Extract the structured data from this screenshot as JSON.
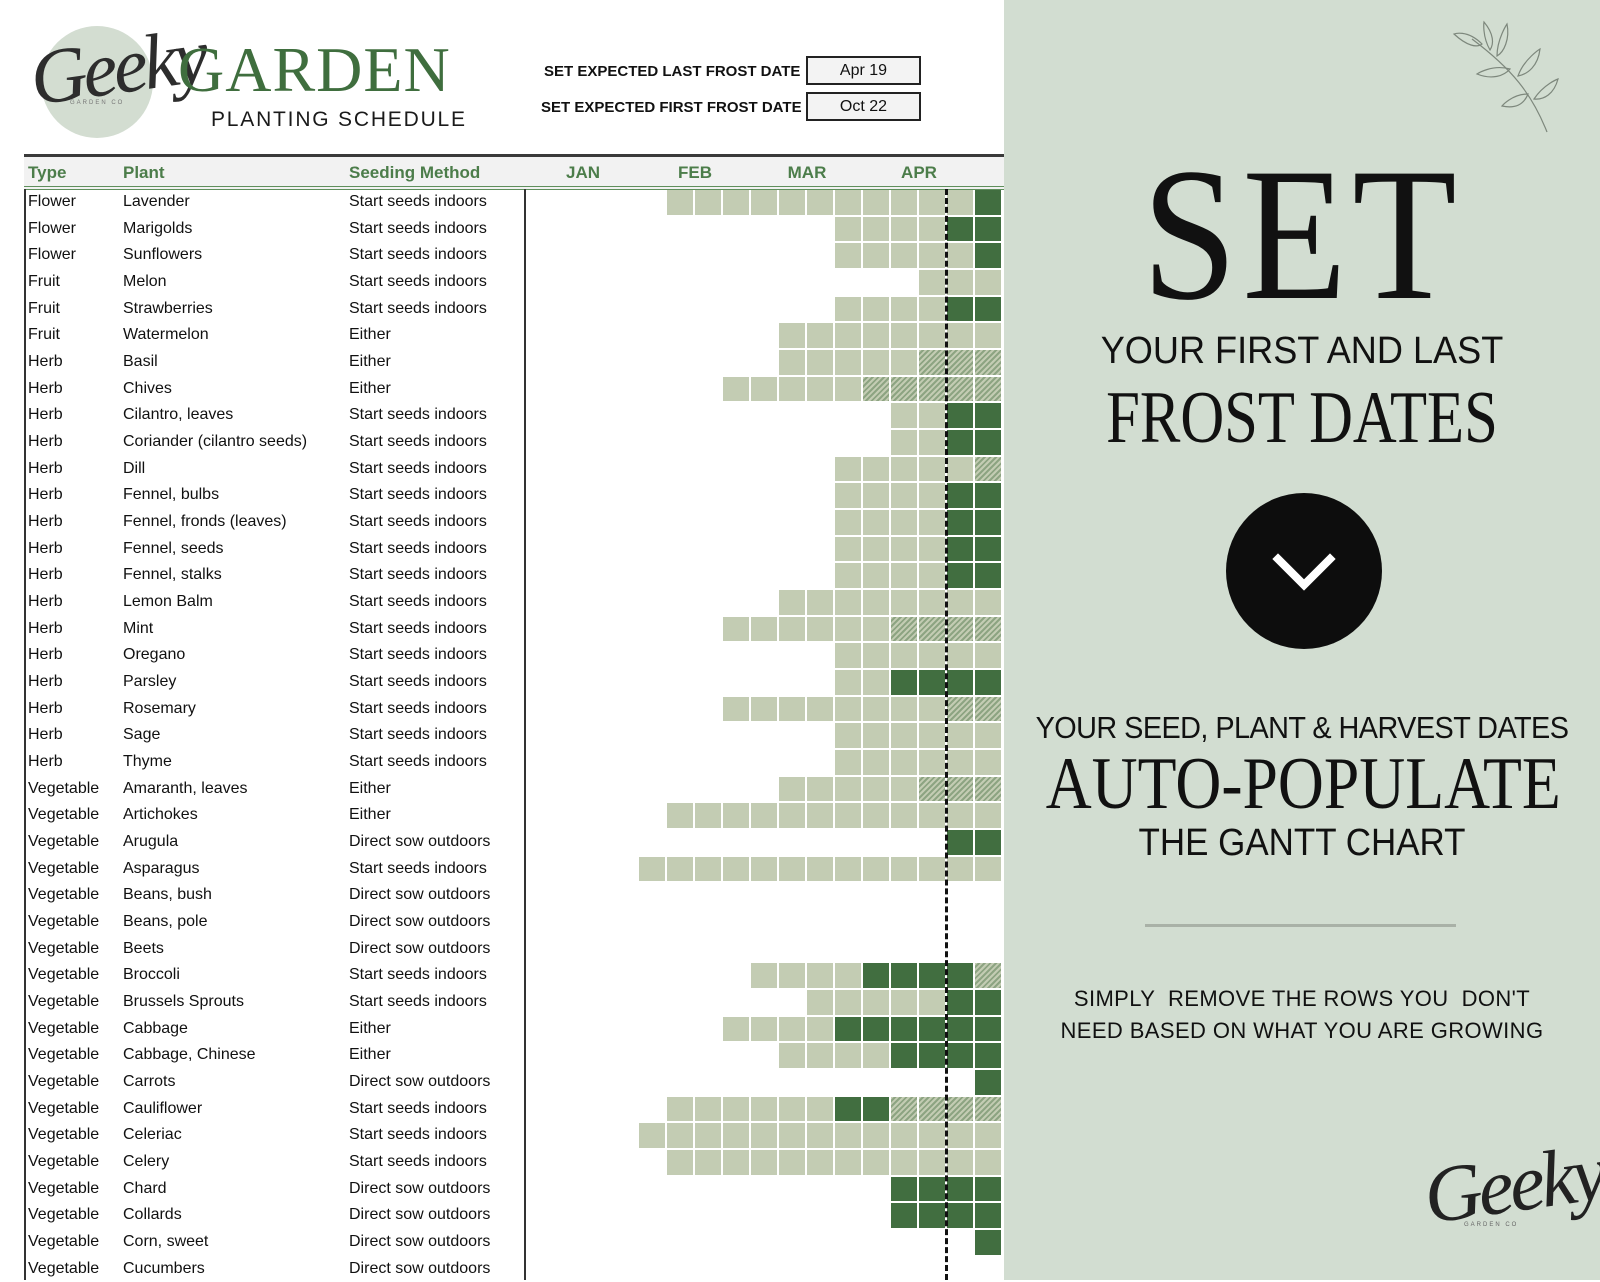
{
  "header": {
    "logo_script": "Geeky",
    "logo_sub": "GARDEN CO",
    "title": "GARDEN",
    "subtitle": "PLANTING SCHEDULE"
  },
  "frost": {
    "last_label": "SET EXPECTED LAST FROST DATE",
    "last_value": "Apr 19",
    "first_label": "SET EXPECTED FIRST FROST DATE",
    "first_value": "Oct 22"
  },
  "table": {
    "columns": [
      "Type",
      "Plant",
      "Seeding Method"
    ],
    "months": [
      "JAN",
      "FEB",
      "MAR",
      "APR"
    ]
  },
  "colors": {
    "light": "#c3ccb3",
    "dark": "#416e40",
    "hatched": "#8da482",
    "title_green": "#3f6e3e",
    "panel_bg": "#d2ddd1"
  },
  "chart_data": {
    "type": "gantt",
    "time_axis": {
      "unit": "week",
      "month_labels": [
        "JAN",
        "FEB",
        "MAR",
        "APR"
      ],
      "weeks_per_month": 4,
      "visible_weeks": 17
    },
    "frost_marker": {
      "date": "Apr 19",
      "style": "dashed"
    },
    "rows": [
      {
        "type": "Flower",
        "plant": "Lavender",
        "method": "Start seeds indoors",
        "bars": [
          [
            "light",
            6,
            16
          ],
          [
            "dark",
            17,
            17
          ]
        ]
      },
      {
        "type": "Flower",
        "plant": "Marigolds",
        "method": "Start seeds indoors",
        "bars": [
          [
            "light",
            12,
            15
          ],
          [
            "dark",
            16,
            17
          ]
        ]
      },
      {
        "type": "Flower",
        "plant": "Sunflowers",
        "method": "Start seeds indoors",
        "bars": [
          [
            "light",
            12,
            16
          ],
          [
            "dark",
            17,
            17
          ]
        ]
      },
      {
        "type": "Fruit",
        "plant": "Melon",
        "method": "Start seeds indoors",
        "bars": [
          [
            "light",
            15,
            17
          ]
        ]
      },
      {
        "type": "Fruit",
        "plant": "Strawberries",
        "method": "Start seeds indoors",
        "bars": [
          [
            "light",
            12,
            15
          ],
          [
            "dark",
            16,
            17
          ]
        ]
      },
      {
        "type": "Fruit",
        "plant": "Watermelon",
        "method": "Either",
        "bars": [
          [
            "light",
            10,
            17
          ]
        ]
      },
      {
        "type": "Herb",
        "plant": "Basil",
        "method": "Either",
        "bars": [
          [
            "light",
            10,
            14
          ],
          [
            "hatched",
            15,
            17
          ]
        ]
      },
      {
        "type": "Herb",
        "plant": "Chives",
        "method": "Either",
        "bars": [
          [
            "light",
            8,
            12
          ],
          [
            "hatched",
            13,
            17
          ]
        ]
      },
      {
        "type": "Herb",
        "plant": "Cilantro, leaves",
        "method": "Start seeds indoors",
        "bars": [
          [
            "light",
            14,
            15
          ],
          [
            "dark",
            16,
            17
          ]
        ]
      },
      {
        "type": "Herb",
        "plant": "Coriander (cilantro seeds)",
        "method": "Start seeds indoors",
        "bars": [
          [
            "light",
            14,
            15
          ],
          [
            "dark",
            16,
            17
          ]
        ]
      },
      {
        "type": "Herb",
        "plant": "Dill",
        "method": "Start seeds indoors",
        "bars": [
          [
            "light",
            12,
            16
          ],
          [
            "hatched",
            17,
            17
          ]
        ]
      },
      {
        "type": "Herb",
        "plant": "Fennel, bulbs",
        "method": "Start seeds indoors",
        "bars": [
          [
            "light",
            12,
            15
          ],
          [
            "dark",
            16,
            17
          ]
        ]
      },
      {
        "type": "Herb",
        "plant": "Fennel, fronds (leaves)",
        "method": "Start seeds indoors",
        "bars": [
          [
            "light",
            12,
            15
          ],
          [
            "dark",
            16,
            17
          ]
        ]
      },
      {
        "type": "Herb",
        "plant": "Fennel, seeds",
        "method": "Start seeds indoors",
        "bars": [
          [
            "light",
            12,
            15
          ],
          [
            "dark",
            16,
            17
          ]
        ]
      },
      {
        "type": "Herb",
        "plant": "Fennel, stalks",
        "method": "Start seeds indoors",
        "bars": [
          [
            "light",
            12,
            15
          ],
          [
            "dark",
            16,
            17
          ]
        ]
      },
      {
        "type": "Herb",
        "plant": "Lemon Balm",
        "method": "Start seeds indoors",
        "bars": [
          [
            "light",
            10,
            17
          ]
        ]
      },
      {
        "type": "Herb",
        "plant": "Mint",
        "method": "Start seeds indoors",
        "bars": [
          [
            "light",
            8,
            13
          ],
          [
            "hatched",
            14,
            17
          ]
        ]
      },
      {
        "type": "Herb",
        "plant": "Oregano",
        "method": "Start seeds indoors",
        "bars": [
          [
            "light",
            12,
            17
          ]
        ]
      },
      {
        "type": "Herb",
        "plant": "Parsley",
        "method": "Start seeds indoors",
        "bars": [
          [
            "light",
            12,
            13
          ],
          [
            "dark",
            14,
            17
          ]
        ]
      },
      {
        "type": "Herb",
        "plant": "Rosemary",
        "method": "Start seeds indoors",
        "bars": [
          [
            "light",
            8,
            15
          ],
          [
            "hatched",
            16,
            17
          ]
        ]
      },
      {
        "type": "Herb",
        "plant": "Sage",
        "method": "Start seeds indoors",
        "bars": [
          [
            "light",
            12,
            17
          ]
        ]
      },
      {
        "type": "Herb",
        "plant": "Thyme",
        "method": "Start seeds indoors",
        "bars": [
          [
            "light",
            12,
            17
          ]
        ]
      },
      {
        "type": "Vegetable",
        "plant": "Amaranth, leaves",
        "method": "Either",
        "bars": [
          [
            "light",
            10,
            14
          ],
          [
            "hatched",
            15,
            17
          ]
        ]
      },
      {
        "type": "Vegetable",
        "plant": "Artichokes",
        "method": "Either",
        "bars": [
          [
            "light",
            6,
            17
          ]
        ]
      },
      {
        "type": "Vegetable",
        "plant": "Arugula",
        "method": "Direct sow outdoors",
        "bars": [
          [
            "dark",
            16,
            17
          ]
        ]
      },
      {
        "type": "Vegetable",
        "plant": "Asparagus",
        "method": "Start seeds indoors",
        "bars": [
          [
            "light",
            5,
            17
          ]
        ]
      },
      {
        "type": "Vegetable",
        "plant": "Beans, bush",
        "method": "Direct sow outdoors",
        "bars": []
      },
      {
        "type": "Vegetable",
        "plant": "Beans, pole",
        "method": "Direct sow outdoors",
        "bars": []
      },
      {
        "type": "Vegetable",
        "plant": "Beets",
        "method": "Direct sow outdoors",
        "bars": []
      },
      {
        "type": "Vegetable",
        "plant": "Broccoli",
        "method": "Start seeds indoors",
        "bars": [
          [
            "light",
            9,
            12
          ],
          [
            "dark",
            13,
            16
          ],
          [
            "hatched",
            17,
            17
          ]
        ]
      },
      {
        "type": "Vegetable",
        "plant": "Brussels Sprouts",
        "method": "Start seeds indoors",
        "bars": [
          [
            "light",
            11,
            15
          ],
          [
            "dark",
            16,
            17
          ]
        ]
      },
      {
        "type": "Vegetable",
        "plant": "Cabbage",
        "method": "Either",
        "bars": [
          [
            "light",
            8,
            11
          ],
          [
            "dark",
            12,
            17
          ]
        ]
      },
      {
        "type": "Vegetable",
        "plant": "Cabbage, Chinese",
        "method": "Either",
        "bars": [
          [
            "light",
            10,
            13
          ],
          [
            "dark",
            14,
            17
          ]
        ]
      },
      {
        "type": "Vegetable",
        "plant": "Carrots",
        "method": "Direct sow outdoors",
        "bars": [
          [
            "dark",
            17,
            17
          ]
        ]
      },
      {
        "type": "Vegetable",
        "plant": "Cauliflower",
        "method": "Start seeds indoors",
        "bars": [
          [
            "light",
            6,
            11
          ],
          [
            "dark",
            12,
            13
          ],
          [
            "hatched",
            14,
            17
          ]
        ]
      },
      {
        "type": "Vegetable",
        "plant": "Celeriac",
        "method": "Start seeds indoors",
        "bars": [
          [
            "light",
            5,
            17
          ]
        ]
      },
      {
        "type": "Vegetable",
        "plant": "Celery",
        "method": "Start seeds indoors",
        "bars": [
          [
            "light",
            6,
            17
          ]
        ]
      },
      {
        "type": "Vegetable",
        "plant": "Chard",
        "method": "Direct sow outdoors",
        "bars": [
          [
            "dark",
            14,
            17
          ]
        ]
      },
      {
        "type": "Vegetable",
        "plant": "Collards",
        "method": "Direct sow outdoors",
        "bars": [
          [
            "dark",
            14,
            17
          ]
        ]
      },
      {
        "type": "Vegetable",
        "plant": "Corn, sweet",
        "method": "Direct sow outdoors",
        "bars": [
          [
            "dark",
            17,
            17
          ]
        ]
      },
      {
        "type": "Vegetable",
        "plant": "Cucumbers",
        "method": "Direct sow outdoors",
        "bars": []
      }
    ]
  },
  "panel": {
    "line1": "SET",
    "line2": "YOUR FIRST AND LAST",
    "line3": "FROST DATES",
    "line4": "YOUR SEED, PLANT & HARVEST DATES",
    "line5": "AUTO-POPULATE",
    "line6": "THE GANTT CHART",
    "note1": "SIMPLY  REMOVE THE ROWS YOU  DON'T",
    "note2": "NEED BASED ON WHAT YOU ARE GROWING",
    "logo_script": "Geeky",
    "logo_sub": "GARDEN CO"
  }
}
